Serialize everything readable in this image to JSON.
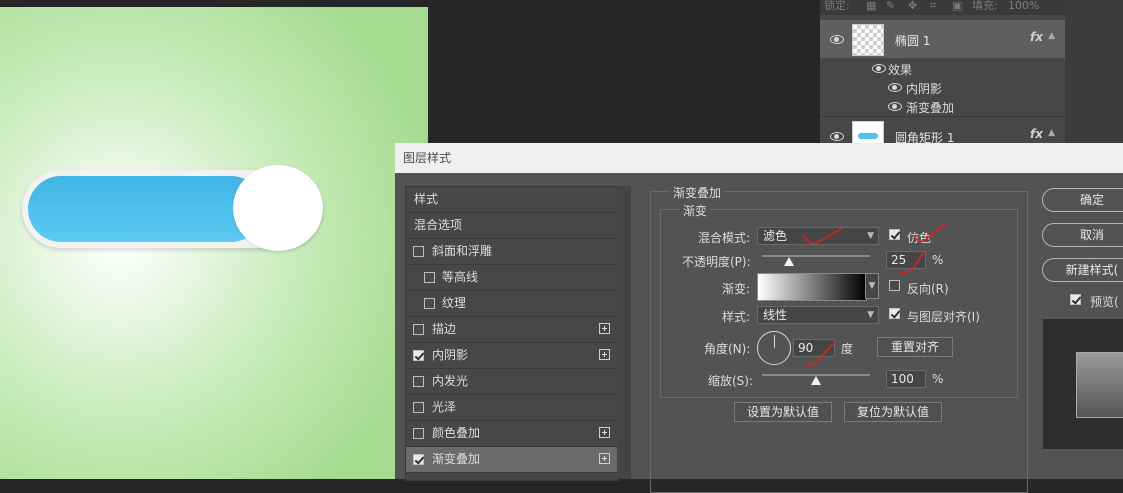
{
  "layers_panel": {
    "lock_label": "锁定:",
    "fill_label": "填充:",
    "fill_value": "100%",
    "layers": [
      {
        "name": "椭圆 1",
        "fx": "fx",
        "selected": true
      },
      {
        "name": "圆角矩形 1",
        "fx": "fx",
        "selected": false
      }
    ],
    "effects_label": "效果",
    "effects": [
      "内阴影",
      "渐变叠加"
    ]
  },
  "dialog": {
    "title": "图层样式",
    "styles": [
      {
        "label": "样式",
        "checkbox": false
      },
      {
        "label": "混合选项",
        "checkbox": false
      },
      {
        "label": "斜面和浮雕",
        "checkbox": true,
        "checked": false
      },
      {
        "label": "等高线",
        "checkbox": true,
        "checked": false,
        "indent": true
      },
      {
        "label": "纹理",
        "checkbox": true,
        "checked": false,
        "indent": true
      },
      {
        "label": "描边",
        "checkbox": true,
        "checked": false,
        "plus": true
      },
      {
        "label": "内阴影",
        "checkbox": true,
        "checked": true,
        "plus": true
      },
      {
        "label": "内发光",
        "checkbox": true,
        "checked": false
      },
      {
        "label": "光泽",
        "checkbox": true,
        "checked": false
      },
      {
        "label": "颜色叠加",
        "checkbox": true,
        "checked": false,
        "plus": true
      },
      {
        "label": "渐变叠加",
        "checkbox": true,
        "checked": true,
        "plus": true,
        "selected": true
      }
    ],
    "section_title": "渐变叠加",
    "group_title": "渐变",
    "blend_mode_label": "混合模式:",
    "blend_mode_value": "滤色",
    "dither_label": "仿色",
    "dither_checked": true,
    "opacity_label": "不透明度(P):",
    "opacity_value": "25",
    "opacity_unit": "%",
    "opacity_level": 0.25,
    "gradient_label": "渐变:",
    "reverse_label": "反向(R)",
    "reverse_checked": false,
    "style_label": "样式:",
    "style_value": "线性",
    "align_label": "与图层对齐(I)",
    "align_checked": true,
    "angle_label": "角度(N):",
    "angle_value": "90",
    "angle_unit": "度",
    "reset_align_button": "重置对齐",
    "scale_label": "缩放(S):",
    "scale_value": "100",
    "scale_unit": "%",
    "scale_level": 0.5,
    "set_default_button": "设置为默认值",
    "reset_default_button": "复位为默认值",
    "ok_button": "确定",
    "cancel_button": "取消",
    "new_style_button": "新建样式(",
    "preview_label": "预览(",
    "preview_checked": true
  },
  "colors": {
    "switch_blue": "#4fc1ee",
    "canvas_green": "#a5db90",
    "annotation_red": "#e02020"
  }
}
